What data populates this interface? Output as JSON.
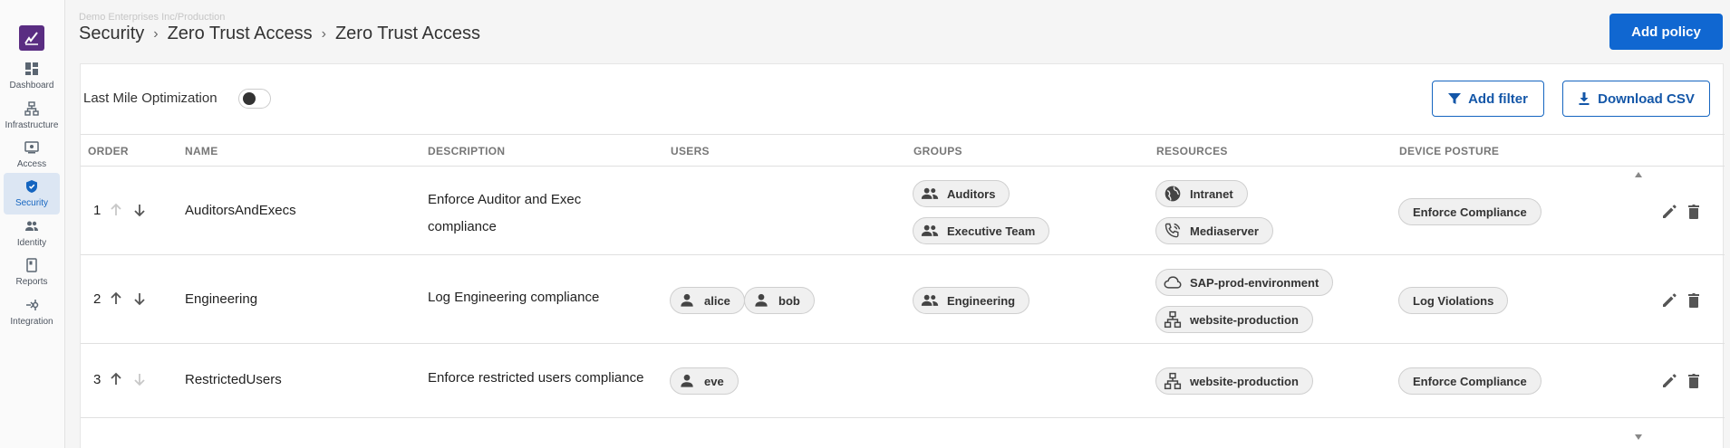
{
  "org_path": "Demo Enterprises Inc/Production",
  "breadcrumbs": [
    "Security",
    "Zero Trust Access",
    "Zero Trust Access"
  ],
  "add_policy_label": "Add policy",
  "sidebar": {
    "items": [
      {
        "label": "Dashboard",
        "icon": "dashboard-icon"
      },
      {
        "label": "Infrastructure",
        "icon": "infrastructure-icon"
      },
      {
        "label": "Access",
        "icon": "access-icon"
      },
      {
        "label": "Security",
        "icon": "shield-icon",
        "active": true
      },
      {
        "label": "Identity",
        "icon": "people-icon"
      },
      {
        "label": "Reports",
        "icon": "report-icon"
      },
      {
        "label": "Integration",
        "icon": "integration-icon"
      }
    ]
  },
  "toolbar": {
    "last_mile_label": "Last Mile Optimization",
    "last_mile_enabled": false,
    "add_filter_label": "Add filter",
    "download_csv_label": "Download CSV"
  },
  "table": {
    "headers": [
      "ORDER",
      "NAME",
      "DESCRIPTION",
      "USERS",
      "GROUPS",
      "RESOURCES",
      "DEVICE POSTURE"
    ],
    "rows": [
      {
        "order": "1",
        "name": "AuditorsAndExecs",
        "description": "Enforce Auditor and Exec compliance",
        "users": [],
        "groups": [
          "Auditors",
          "Executive Team"
        ],
        "resources": [
          {
            "name": "Intranet",
            "icon": "globe-icon"
          },
          {
            "name": "Mediaserver",
            "icon": "phone-wave-icon"
          }
        ],
        "device_posture": "Enforce Compliance"
      },
      {
        "order": "2",
        "name": "Engineering",
        "description": "Log Engineering compliance",
        "users": [
          "alice",
          "bob"
        ],
        "groups": [
          "Engineering"
        ],
        "resources": [
          {
            "name": "SAP-prod-environment",
            "icon": "cloud-icon"
          },
          {
            "name": "website-production",
            "icon": "network-icon"
          }
        ],
        "device_posture": "Log Violations"
      },
      {
        "order": "3",
        "name": "RestrictedUsers",
        "description": "Enforce restricted users compliance",
        "users": [
          "eve"
        ],
        "groups": [],
        "resources": [
          {
            "name": "website-production",
            "icon": "network-icon"
          }
        ],
        "device_posture": "Enforce Compliance"
      }
    ]
  },
  "colors": {
    "primary": "#1067d1",
    "brand": "#5a2d82",
    "active_nav_bg": "#dce6f3"
  }
}
